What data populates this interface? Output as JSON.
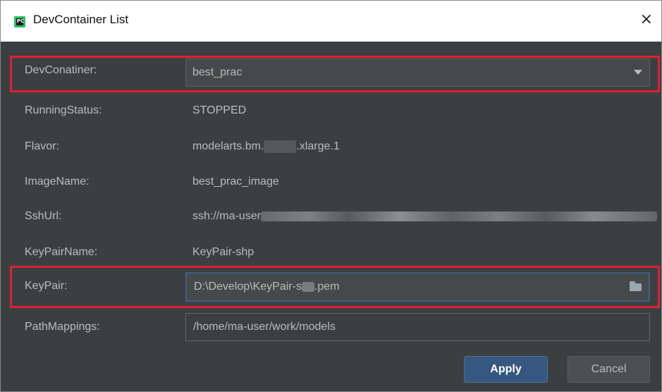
{
  "window": {
    "title": "DevContainer List",
    "app_icon_text": "PC",
    "close_glyph": "×"
  },
  "form": {
    "devcontainer": {
      "label": "DevConatiner:",
      "value": "best_prac"
    },
    "running_status": {
      "label": "RunningStatus:",
      "value": "STOPPED"
    },
    "flavor": {
      "label": "Flavor:",
      "value_prefix": "modelarts.bm.",
      "value_suffix": ".xlarge.1"
    },
    "image_name": {
      "label": "ImageName:",
      "value": "best_prac_image"
    },
    "ssh_url": {
      "label": "SshUrl:",
      "value_prefix": "ssh://ma-user"
    },
    "key_pair_name": {
      "label": "KeyPairName:",
      "value": "KeyPair-shp"
    },
    "key_pair": {
      "label": "KeyPair:",
      "value_prefix": "D:\\Develop\\KeyPair-s",
      "value_suffix": ".pem"
    },
    "path_mappings": {
      "label": "PathMappings:",
      "value": "/home/ma-user/work/models"
    }
  },
  "buttons": {
    "apply": "Apply",
    "cancel": "Cancel"
  },
  "colors": {
    "dialog_bg": "#3c3f41",
    "highlight": "#e0202f",
    "apply_bg": "#365880"
  },
  "icons": [
    "app-icon",
    "close-icon",
    "dropdown-arrow-icon",
    "folder-icon"
  ]
}
